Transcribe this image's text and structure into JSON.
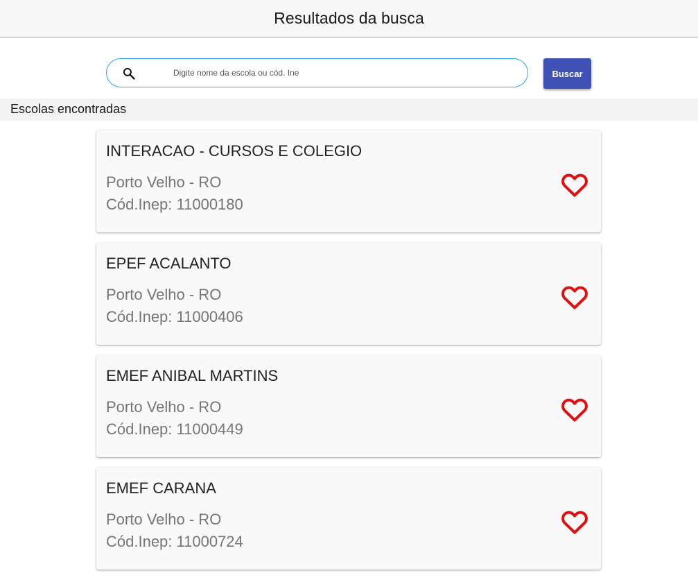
{
  "header": {
    "title": "Resultados da busca"
  },
  "search": {
    "placeholder": "Digite nome da escola ou cód. Ine",
    "value": "",
    "button_label": "Buscar",
    "icon": "search-icon"
  },
  "section": {
    "title": "Escolas encontradas"
  },
  "schools": [
    {
      "name": "INTERACAO - CURSOS E COLEGIO",
      "city": "Porto Velho - RO",
      "inep": "Cód.Inep: 11000180",
      "favorite_icon": "heart-outline-icon"
    },
    {
      "name": "EPEF ACALANTO",
      "city": "Porto Velho - RO",
      "inep": "Cód.Inep: 11000406",
      "favorite_icon": "heart-outline-icon"
    },
    {
      "name": "EMEF ANIBAL MARTINS",
      "city": "Porto Velho - RO",
      "inep": "Cód.Inep: 11000449",
      "favorite_icon": "heart-outline-icon"
    },
    {
      "name": "EMEF CARANA",
      "city": "Porto Velho - RO",
      "inep": "Cód.Inep: 11000724",
      "favorite_icon": "heart-outline-icon"
    }
  ],
  "colors": {
    "accent_button": "#3f51b5",
    "search_border": "#29a7df",
    "heart": "#e01010",
    "secondary_text": "#757575"
  }
}
